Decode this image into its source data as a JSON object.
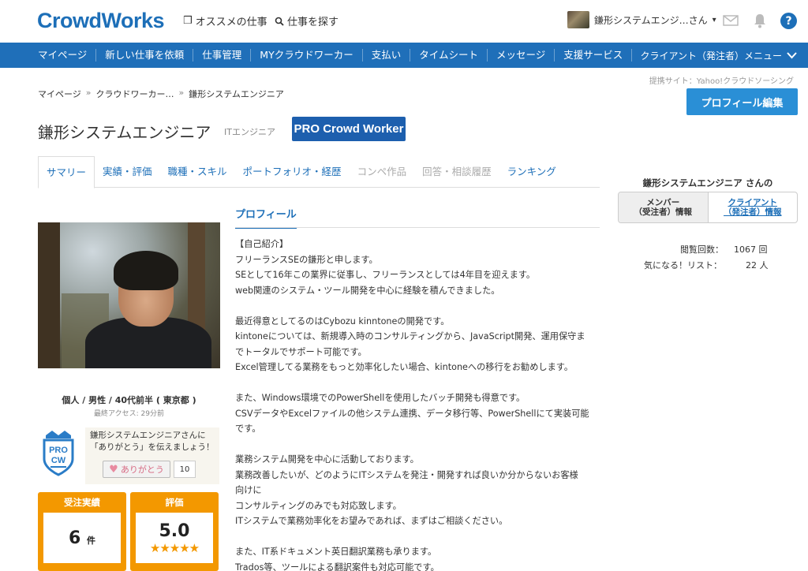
{
  "header": {
    "logo": "CrowdWorks",
    "recommend_label": "オススメの仕事",
    "search_label": "仕事を探す",
    "user_name": "鎌形システムエンジ…さん",
    "caret": "▾"
  },
  "nav": {
    "items": [
      "マイページ",
      "新しい仕事を依頼",
      "仕事管理",
      "MYクラウドワーカー",
      "支払い",
      "タイムシート",
      "メッセージ",
      "支援サービス"
    ],
    "right_menu": "クライアント（発注者）メニュー"
  },
  "breadcrumb": {
    "items": [
      "マイページ",
      "クラウドワーカー…",
      "鎌形システムエンジニア"
    ],
    "sep": "»"
  },
  "partner_site": "提携サイト：Yahoo!クラウドソーシング",
  "edit_button": "プロフィール編集",
  "profile": {
    "name": "鎌形システムエンジニア",
    "category": "ITエンジニア",
    "badge": "PRO Crowd Worker",
    "info": "個人 / 男性 / 40代前半 ( 東京都 )",
    "last_access": "最終アクセス: 29分前"
  },
  "tabs": [
    {
      "label": "サマリー",
      "state": "active"
    },
    {
      "label": "実績・評価",
      "state": "normal"
    },
    {
      "label": "職種・スキル",
      "state": "normal"
    },
    {
      "label": "ポートフォリオ・経歴",
      "state": "normal"
    },
    {
      "label": "コンペ作品",
      "state": "disabled"
    },
    {
      "label": "回答・相談履歴",
      "state": "disabled"
    },
    {
      "label": "ランキング",
      "state": "normal"
    }
  ],
  "thanks": {
    "line1": "鎌形システムエンジニアさんに",
    "line2": "「ありがとう」を伝えましょう！",
    "button": "ありがとう",
    "count": "10",
    "shield_top": "PRO",
    "shield_bottom": "CW"
  },
  "stats": {
    "orders_label": "受注実績",
    "orders_value": "6",
    "orders_unit": "件",
    "rating_label": "評価",
    "rating_value": "5.0",
    "stars": "★★★★★"
  },
  "section_title": "プロフィール",
  "profile_text": [
    "【自己紹介】",
    "フリーランスSEの鎌形と申します。",
    "SEとして16年この業界に従事し、フリーランスとしては4年目を迎えます。",
    "web関連のシステム・ツール開発を中心に経験を積んできました。",
    "",
    "最近得意としてるのはCybozu kinntoneの開発です。",
    "kintoneについては、新規導入時のコンサルティングから、JavaScript開発、運用保守ま",
    "でトータルでサポート可能です。",
    "Excel管理してる業務をもっと効率化したい場合、kintoneへの移行をお勧めします。",
    "",
    "また、Windows環境でのPowerShellを使用したバッチ開発も得意です。",
    "CSVデータやExcelファイルの他システム連携、データ移行等、PowerShellにて実装可能",
    "です。",
    "",
    "業務システム開発を中心に活動しております。",
    "業務改善したいが、どのようにITシステムを発注・開発すれば良いか分からないお客様",
    "向けに",
    "コンサルティングのみでも対応致します。",
    "ITシステムで業務効率化をお望みであれば、まずはご相談ください。",
    "",
    "また、IT系ドキュメント英日翻訳業務も承ります。",
    "Trados等、ツールによる翻訳案件も対応可能です。"
  ],
  "sidebar": {
    "name": "鎌形システムエンジニア さんの",
    "member_line1": "メンバー",
    "member_line2": "（受注者）情報",
    "client_line1": "クライアント",
    "client_line2": "（発注者）情報",
    "views_label": "閲覧回数：",
    "views_value": "1067 回",
    "fav_label": "気になる！リスト：",
    "fav_value": "22 人"
  },
  "colors": {
    "brand_blue": "#1d6fb8",
    "nav_blue": "#1f6fb9",
    "orange": "#f39800"
  }
}
